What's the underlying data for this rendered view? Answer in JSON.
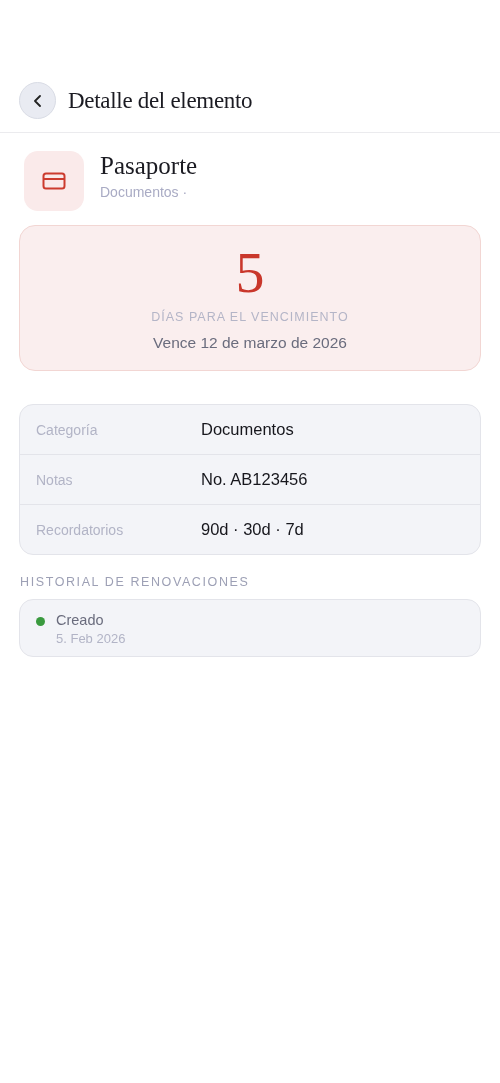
{
  "header": {
    "title": "Detalle del elemento"
  },
  "item": {
    "name": "Pasaporte",
    "subtitle": "Documentos ·"
  },
  "expiry": {
    "days": "5",
    "label": "DÍAS PARA EL VENCIMIENTO",
    "date": "Vence 12 de marzo de 2026"
  },
  "details": [
    {
      "label": "Categoría",
      "value": "Documentos"
    },
    {
      "label": "Notas",
      "value": "No. AB123456"
    },
    {
      "label": "Recordatorios",
      "value": "90d · 30d · 7d"
    }
  ],
  "history": {
    "title": "HISTORIAL DE RENOVACIONES",
    "entries": [
      {
        "event": "Creado",
        "date": "5. Feb 2026",
        "color": "#3a9a3f"
      }
    ]
  }
}
